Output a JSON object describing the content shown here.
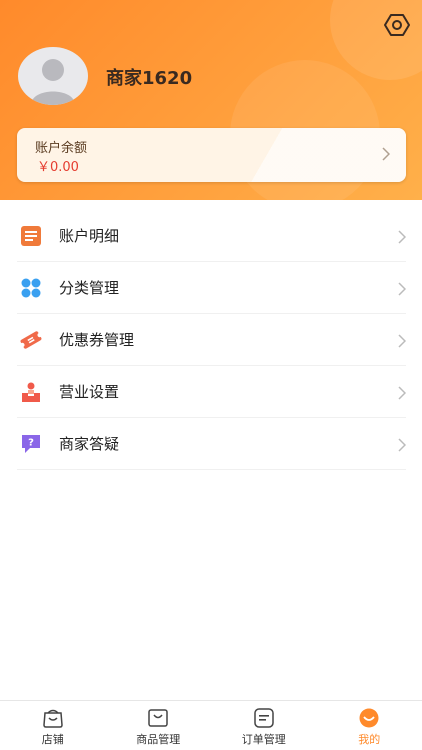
{
  "profile": {
    "name": "商家1620"
  },
  "icons": {
    "settings": "settings-icon",
    "avatar": "user-avatar-icon",
    "chevron": "chevron-right-icon"
  },
  "balance": {
    "title": "账户余额",
    "value": "￥0.00"
  },
  "menu": [
    {
      "label": "账户明细",
      "icon": "account-detail-icon",
      "color": "#f07a3a"
    },
    {
      "label": "分类管理",
      "icon": "category-icon",
      "color": "#3aa0f0"
    },
    {
      "label": "优惠券管理",
      "icon": "coupon-icon",
      "color": "#f06a4a"
    },
    {
      "label": "营业设置",
      "icon": "business-settings-icon",
      "color": "#f05a4a"
    },
    {
      "label": "商家答疑",
      "icon": "faq-icon",
      "color": "#8a66e8"
    }
  ],
  "tabs": [
    {
      "label": "店铺",
      "icon": "shop-icon",
      "active": false
    },
    {
      "label": "商品管理",
      "icon": "product-icon",
      "active": false
    },
    {
      "label": "订单管理",
      "icon": "order-icon",
      "active": false
    },
    {
      "label": "我的",
      "icon": "profile-icon",
      "active": true
    }
  ],
  "colors": {
    "accent": "#ff8a2b",
    "price": "#e53d30"
  }
}
